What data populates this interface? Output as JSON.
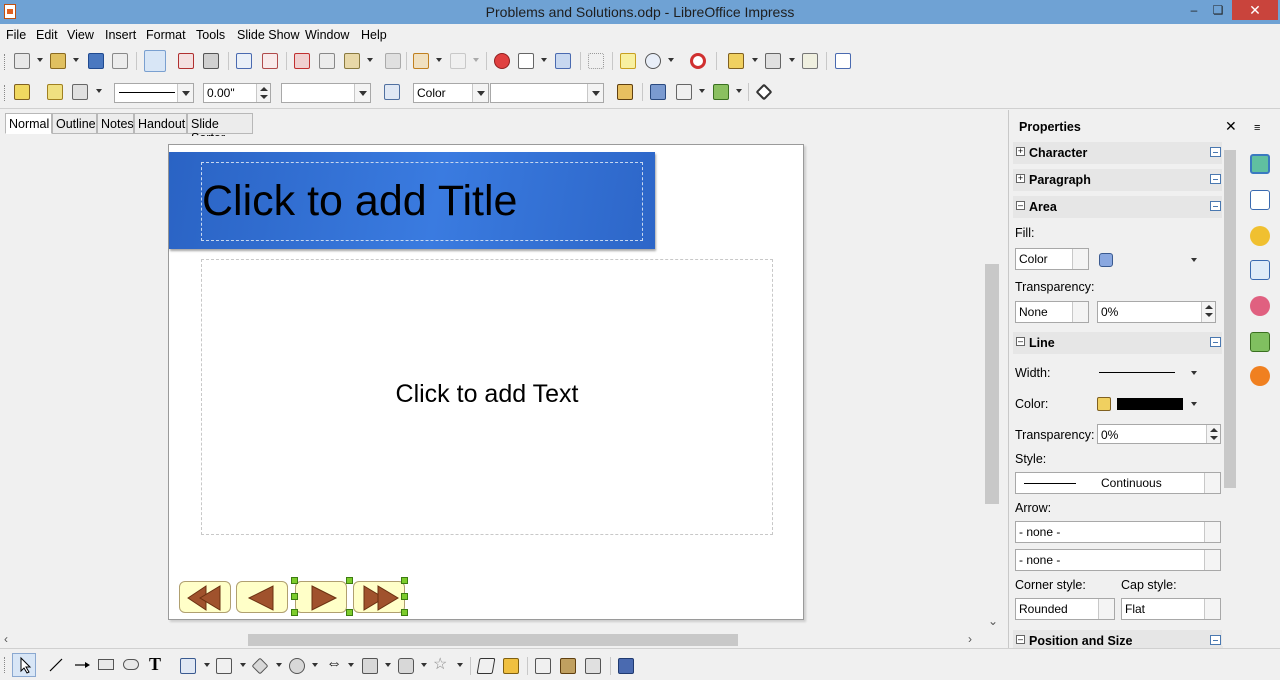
{
  "window": {
    "title": "Problems and Solutions.odp - LibreOffice Impress",
    "minimize": "–",
    "maximize": "❏",
    "close": "✕"
  },
  "menu": [
    "File",
    "Edit",
    "View",
    "Insert",
    "Format",
    "Tools",
    "Slide Show",
    "Window",
    "Help"
  ],
  "toolbar2": {
    "line_width_value": "0.00\"",
    "area_style": "Color"
  },
  "view_tabs": [
    "Normal",
    "Outline",
    "Notes",
    "Handout",
    "Slide Sorter"
  ],
  "slide": {
    "title_placeholder": "Click to add Title",
    "text_placeholder": "Click to add Text",
    "nav_buttons": [
      "first",
      "previous",
      "next",
      "last"
    ]
  },
  "sidebar": {
    "header": "Properties",
    "close": "✕",
    "sections": {
      "character": "Character",
      "paragraph": "Paragraph",
      "area": "Area",
      "line": "Line",
      "position": "Position and Size"
    },
    "area": {
      "fill_label": "Fill:",
      "fill_value": "Color",
      "transparency_label": "Transparency:",
      "transparency_type": "None",
      "transparency_value": "0%"
    },
    "line": {
      "width_label": "Width:",
      "color_label": "Color:",
      "color_value": "#000000",
      "transparency_label": "Transparency:",
      "transparency_value": "0%",
      "style_label": "Style:",
      "style_value": "Continuous",
      "arrow_label": "Arrow:",
      "arrow_start": "- none -",
      "arrow_end": "- none -",
      "corner_label": "Corner style:",
      "corner_value": "Rounded",
      "cap_label": "Cap style:",
      "cap_value": "Flat"
    }
  },
  "colors": {
    "titlebar": "#6fa2d4",
    "title_band": "#2d6ad4",
    "nav_button_fill": "#ffffc8",
    "nav_arrow": "#a0522d",
    "selection_handle": "#7ccc2c"
  }
}
